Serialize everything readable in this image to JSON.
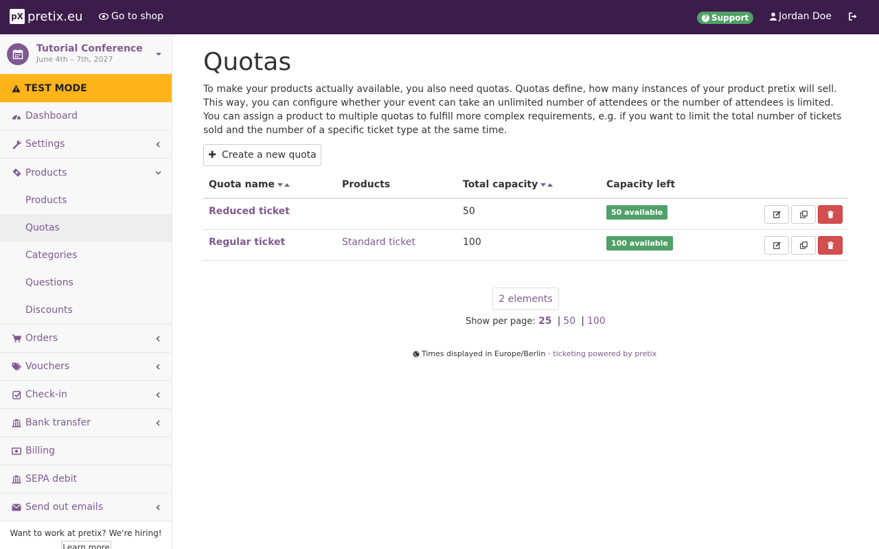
{
  "topbar": {
    "brand": "pretix.eu",
    "brand_logo": "pX",
    "go_to_shop": "Go to shop",
    "support": "Support",
    "user": "Jordan Doe"
  },
  "sidebar": {
    "event_name": "Tutorial Conference",
    "event_date": "June 4th – 7th, 2027",
    "test_mode": "TEST MODE",
    "items": [
      {
        "label": "Dashboard",
        "icon": "dashboard-icon"
      },
      {
        "label": "Settings",
        "icon": "wrench-icon"
      },
      {
        "label": "Products",
        "icon": "ticket-icon"
      },
      {
        "label": "Orders",
        "icon": "cart-icon"
      },
      {
        "label": "Vouchers",
        "icon": "tags-icon"
      },
      {
        "label": "Check-in",
        "icon": "check-square-icon"
      },
      {
        "label": "Bank transfer",
        "icon": "bank-icon"
      },
      {
        "label": "Billing",
        "icon": "money-icon"
      },
      {
        "label": "SEPA debit",
        "icon": "bank-icon"
      },
      {
        "label": "Send out emails",
        "icon": "envelope-icon"
      }
    ],
    "product_sub": [
      "Products",
      "Quotas",
      "Categories",
      "Questions",
      "Discounts"
    ],
    "hiring_text": "Want to work at pretix? We're hiring!",
    "learn_more": "Learn more"
  },
  "main": {
    "title": "Quotas",
    "intro": "To make your products actually available, you also need quotas. Quotas define, how many instances of your product pretix will sell. This way, you can configure whether your event can take an unlimited number of attendees or the number of attendees is limited. You can assign a product to multiple quotas to fulfill more complex requirements, e.g. if you want to limit the total number of tickets sold and the number of a specific ticket type at the same time.",
    "create_button": "Create a new quota",
    "columns": [
      "Quota name",
      "Products",
      "Total capacity",
      "Capacity left"
    ],
    "rows": [
      {
        "name": "Reduced ticket",
        "products": "",
        "capacity": "50",
        "left": "50 available"
      },
      {
        "name": "Regular ticket",
        "products": "Standard ticket",
        "capacity": "100",
        "left": "100 available"
      }
    ],
    "count": "2 elements",
    "per_page_label": "Show per page:",
    "per_page": [
      "25",
      "50",
      "100"
    ],
    "sep": "|",
    "footer_tz": "Times displayed in Europe/Berlin ·",
    "footer_link": "ticketing powered by pretix"
  },
  "colors": {
    "navbar": "#3b1c4a",
    "accent": "#7f5a91",
    "test_mode": "#ffb419",
    "success": "#50a167",
    "danger": "#d24f4f"
  }
}
